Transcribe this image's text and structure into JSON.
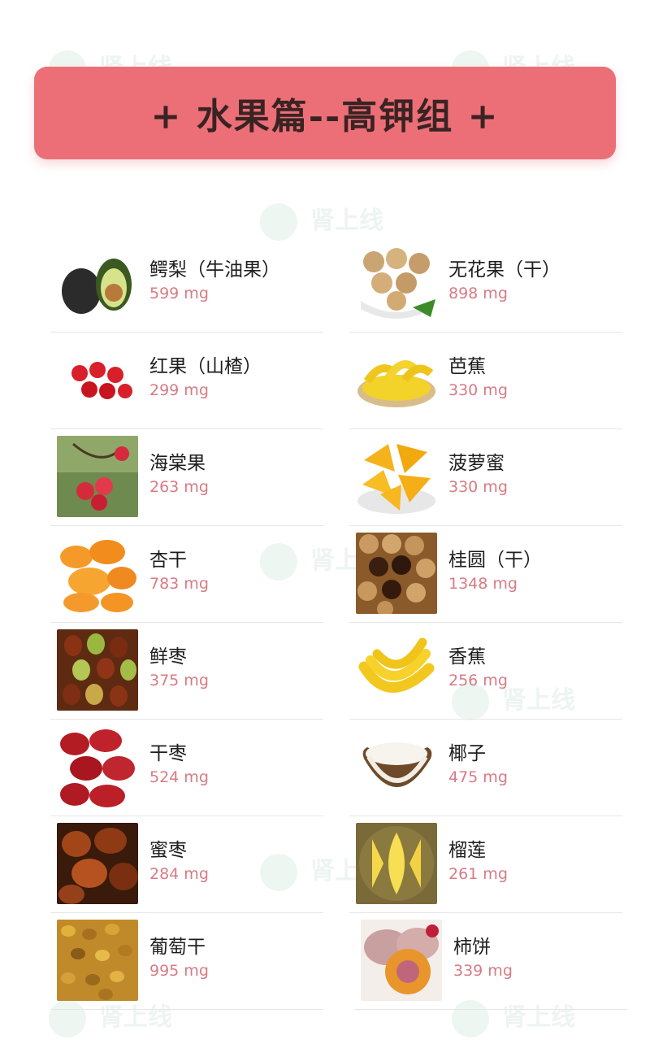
{
  "banner": {
    "title": "+ 水果篇--高钾组 +",
    "color": "#ec6f77"
  },
  "watermark_text": "肾上线",
  "colors": {
    "value_text": "#d77b84",
    "divider": "#e6e6e6"
  },
  "items_left": [
    {
      "name": "鳄梨（牛油果）",
      "value": "599 mg",
      "icon": "avocado-icon"
    },
    {
      "name": "红果（山楂）",
      "value": "299 mg",
      "icon": "hawthorn-icon"
    },
    {
      "name": "海棠果",
      "value": "263 mg",
      "icon": "crabapple-icon"
    },
    {
      "name": "杏干",
      "value": "783 mg",
      "icon": "dried-apricot-icon"
    },
    {
      "name": "鲜枣",
      "value": "375 mg",
      "icon": "fresh-jujube-icon"
    },
    {
      "name": "干枣",
      "value": "524 mg",
      "icon": "dried-jujube-icon"
    },
    {
      "name": "蜜枣",
      "value": "284 mg",
      "icon": "candied-date-icon"
    },
    {
      "name": "葡萄干",
      "value": "995 mg",
      "icon": "raisin-icon"
    }
  ],
  "items_right": [
    {
      "name": "无花果（干）",
      "value": "898 mg",
      "icon": "dried-fig-icon"
    },
    {
      "name": "芭蕉",
      "value": "330 mg",
      "icon": "plantain-icon"
    },
    {
      "name": "菠萝蜜",
      "value": "330 mg",
      "icon": "jackfruit-icon"
    },
    {
      "name": "桂圆（干）",
      "value": "1348 mg",
      "icon": "dried-longan-icon"
    },
    {
      "name": "香蕉",
      "value": "256 mg",
      "icon": "banana-icon"
    },
    {
      "name": "椰子",
      "value": "475 mg",
      "icon": "coconut-icon"
    },
    {
      "name": "榴莲",
      "value": "261 mg",
      "icon": "durian-icon"
    },
    {
      "name": "柿饼",
      "value": "339 mg",
      "icon": "dried-persimmon-icon"
    }
  ]
}
